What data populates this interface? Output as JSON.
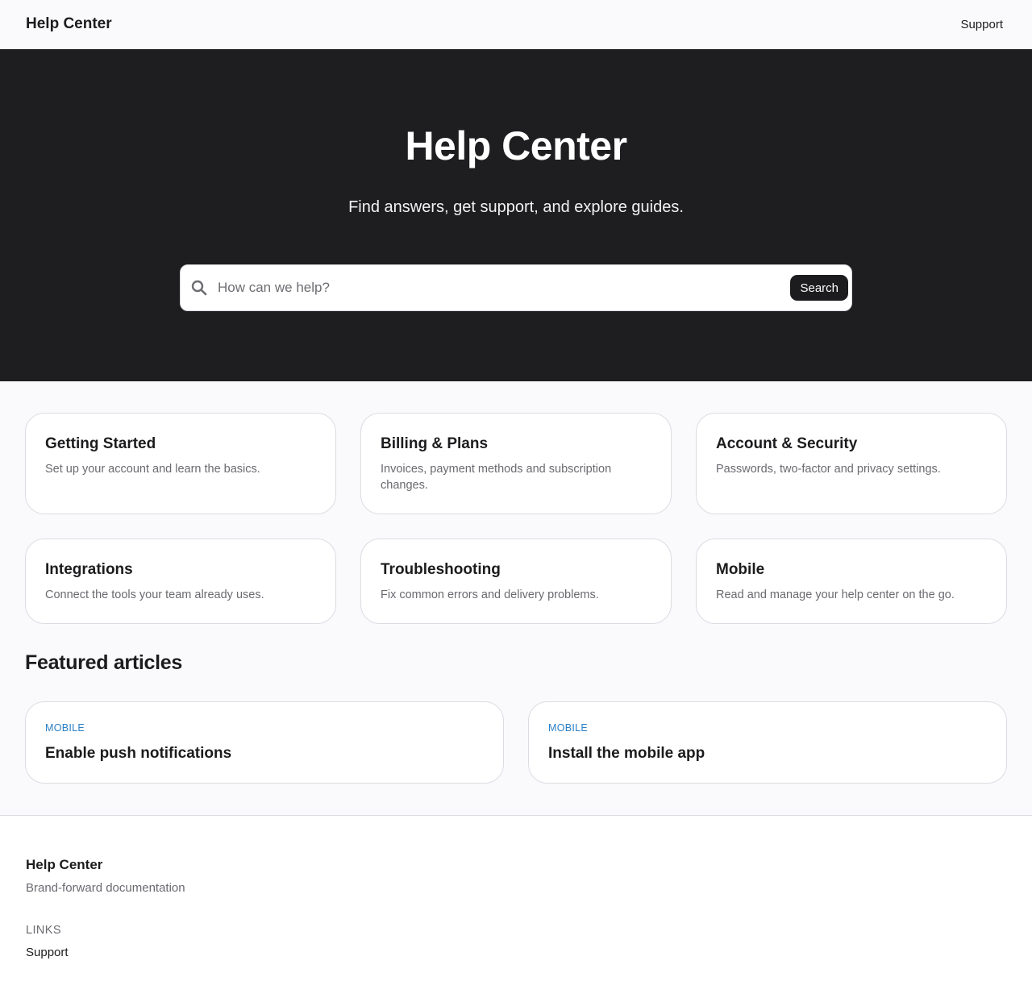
{
  "header": {
    "brand": "Help Center",
    "nav_link": "Support"
  },
  "hero": {
    "title": "Help Center",
    "subtitle": "Find answers, get support, and explore guides.",
    "search_placeholder": "How can we help?",
    "search_button": "Search",
    "search_icon": "search-icon"
  },
  "categories": [
    {
      "title": "Getting Started",
      "description": "Set up your account and learn the basics."
    },
    {
      "title": "Billing & Plans",
      "description": "Invoices, payment methods and subscription changes."
    },
    {
      "title": "Account & Security",
      "description": "Passwords, two-factor and privacy settings."
    },
    {
      "title": "Integrations",
      "description": "Connect the tools your team already uses."
    },
    {
      "title": "Troubleshooting",
      "description": "Fix common errors and delivery problems."
    },
    {
      "title": "Mobile",
      "description": "Read and manage your help center on the go."
    }
  ],
  "featured": {
    "heading": "Featured articles",
    "articles": [
      {
        "tag": "MOBILE",
        "title": "Enable push notifications"
      },
      {
        "tag": "MOBILE",
        "title": "Install the mobile app"
      }
    ]
  },
  "footer": {
    "brand": "Help Center",
    "tagline": "Brand-forward documentation",
    "links_label": "LINKS",
    "links": [
      "Support"
    ]
  },
  "colors": {
    "hero_bg": "#1e1e20",
    "page_bg": "#fafafc",
    "accent_tag": "#2a7fc4",
    "button_bg": "#1c1c1e"
  }
}
